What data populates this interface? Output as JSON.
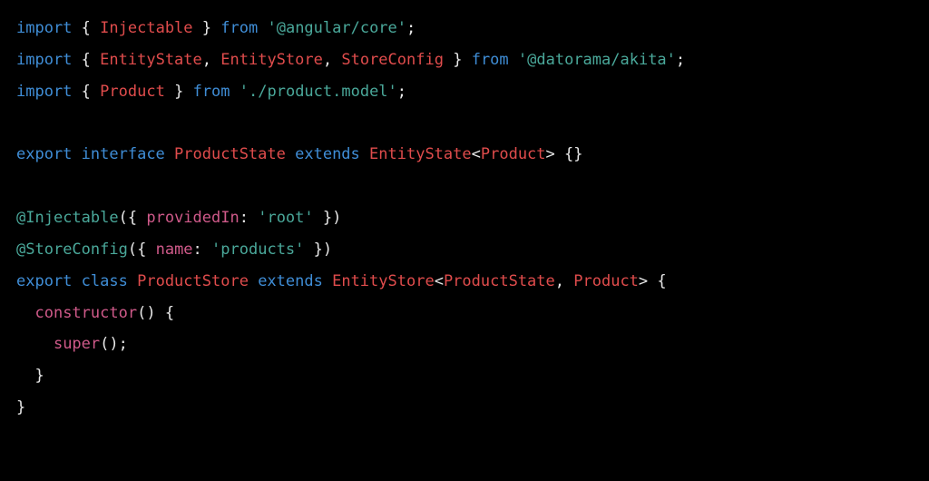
{
  "code": {
    "kw": {
      "import": "import",
      "from": "from",
      "export": "export",
      "interface": "interface",
      "extends": "extends",
      "class": "class"
    },
    "sym": {
      "lbrace": "{",
      "rbrace": "}",
      "lparen": "(",
      "rparen": ")",
      "comma": ",",
      "semicolon": ";",
      "colon": ":",
      "lt": "<",
      "gt": ">",
      "at": "@"
    },
    "ident": {
      "Injectable": "Injectable",
      "EntityState": "EntityState",
      "EntityStore": "EntityStore",
      "StoreConfig": "StoreConfig",
      "Product": "Product",
      "ProductState": "ProductState",
      "ProductStore": "ProductStore"
    },
    "str": {
      "angularCore": "'@angular/core'",
      "datoramaAkita": "'@datorama/akita'",
      "productModel": "'./product.model'",
      "root": "'root'",
      "products": "'products'"
    },
    "prop": {
      "providedIn": "providedIn",
      "name": "name"
    },
    "fn": {
      "constructor": "constructor",
      "super": "super"
    }
  }
}
